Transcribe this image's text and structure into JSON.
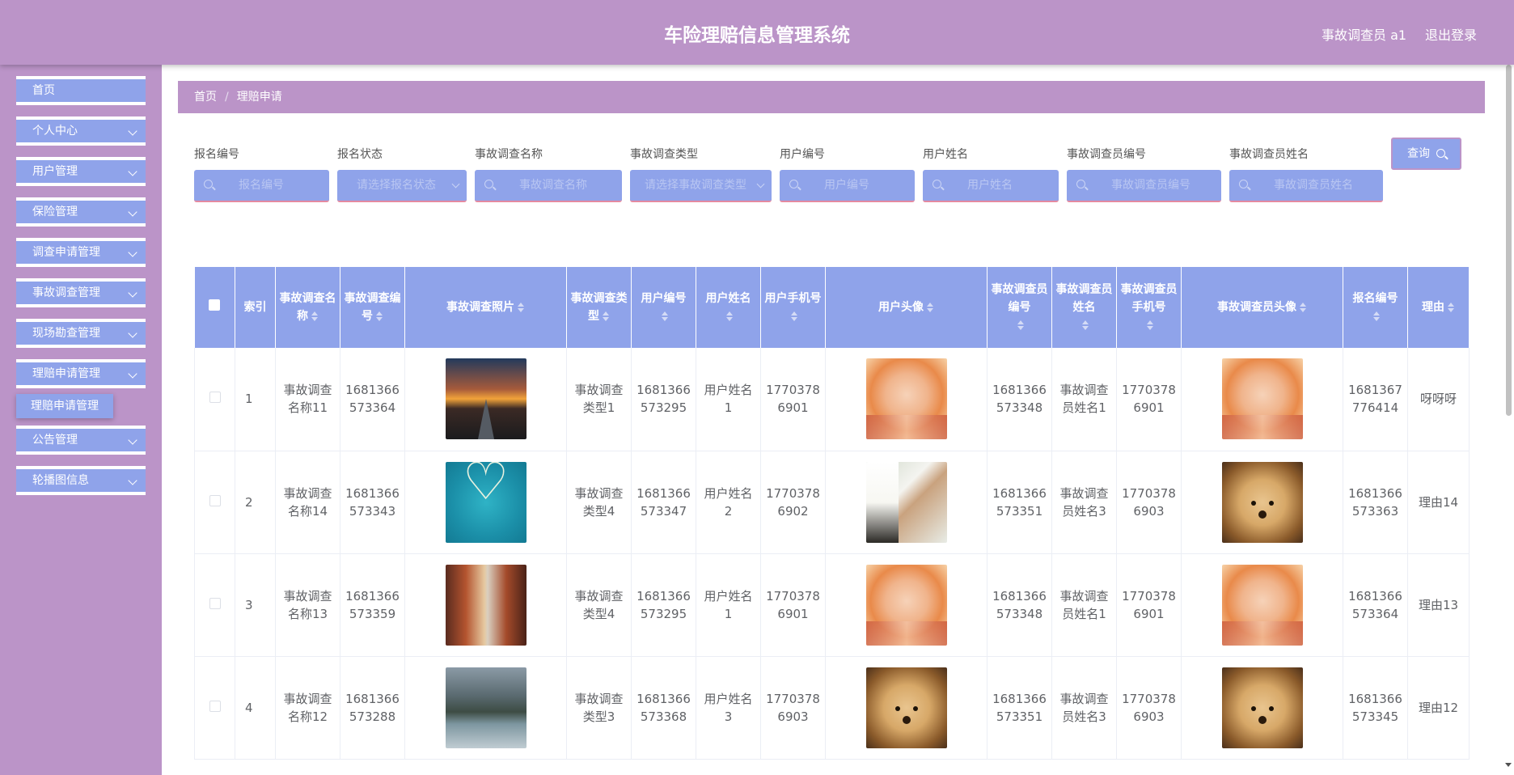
{
  "header": {
    "title": "车险理赔信息管理系统",
    "user": "事故调查员 a1",
    "logout": "退出登录"
  },
  "sidebar": {
    "items": [
      {
        "label": "首页"
      },
      {
        "label": "个人中心"
      },
      {
        "label": "用户管理"
      },
      {
        "label": "保险管理"
      },
      {
        "label": "调查申请管理"
      },
      {
        "label": "事故调查管理"
      },
      {
        "label": "现场勘查管理"
      },
      {
        "label": "理赔申请管理"
      },
      {
        "label": "公告管理"
      },
      {
        "label": "轮播图信息"
      }
    ],
    "active_sub": "理赔申请管理"
  },
  "breadcrumb": {
    "home": "首页",
    "current": "理赔申请"
  },
  "search": {
    "fields": [
      {
        "label": "报名编号",
        "placeholder": "报名编号"
      },
      {
        "label": "报名状态",
        "placeholder": "请选择报名状态"
      },
      {
        "label": "事故调查名称",
        "placeholder": "事故调查名称"
      },
      {
        "label": "事故调查类型",
        "placeholder": "请选择事故调查类型"
      },
      {
        "label": "用户编号",
        "placeholder": "用户编号"
      },
      {
        "label": "用户姓名",
        "placeholder": "用户姓名"
      },
      {
        "label": "事故调查员编号",
        "placeholder": "事故调查员编号"
      },
      {
        "label": "事故调查员姓名",
        "placeholder": "事故调查员姓名"
      }
    ],
    "button": "查询"
  },
  "table": {
    "headers": [
      "索引",
      "事故调查名称",
      "事故调查编号",
      "事故调查照片",
      "事故调查类型",
      "用户编号",
      "用户姓名",
      "用户手机号",
      "用户头像",
      "事故调查员编号",
      "事故调查员姓名",
      "事故调查员手机号",
      "事故调查员头像",
      "报名编号",
      "理由"
    ],
    "rows": [
      {
        "index": "1",
        "name": "事故调查名称11",
        "code": "1681366573364",
        "photo": "sunset-road",
        "type": "事故调查类型1",
        "user_no": "1681366573295",
        "user_name": "用户姓名1",
        "phone": "17703786901",
        "avatar": "smiling-girl",
        "inv_no": "1681366573348",
        "inv_name": "事故调查员姓名1",
        "inv_phone": "17703786901",
        "inv_avatar": "smiling-girl",
        "apply_no": "1681367776414",
        "reason": "呀呀呀"
      },
      {
        "index": "2",
        "name": "事故调查名称14",
        "code": "1681366573343",
        "photo": "heart-island",
        "type": "事故调查类型4",
        "user_no": "1681366573347",
        "user_name": "用户姓名2",
        "phone": "17703786902",
        "avatar": "girl-flowers",
        "inv_no": "1681366573351",
        "inv_name": "事故调查员姓名3",
        "inv_phone": "17703786903",
        "inv_avatar": "puppy",
        "apply_no": "1681366573363",
        "reason": "理由14"
      },
      {
        "index": "3",
        "name": "事故调查名称13",
        "code": "1681366573359",
        "photo": "corridor",
        "type": "事故调查类型4",
        "user_no": "1681366573295",
        "user_name": "用户姓名1",
        "phone": "17703786901",
        "avatar": "smiling-girl",
        "inv_no": "1681366573348",
        "inv_name": "事故调查员姓名1",
        "inv_phone": "17703786901",
        "inv_avatar": "smiling-girl",
        "apply_no": "1681366573364",
        "reason": "理由13"
      },
      {
        "index": "4",
        "name": "事故调查名称12",
        "code": "1681366573288",
        "photo": "mountain-lake",
        "type": "事故调查类型3",
        "user_no": "1681366573368",
        "user_name": "用户姓名3",
        "phone": "17703786903",
        "avatar": "puppy",
        "inv_no": "1681366573351",
        "inv_name": "事故调查员姓名3",
        "inv_phone": "17703786903",
        "inv_avatar": "puppy",
        "apply_no": "1681366573345",
        "reason": "理由12"
      }
    ]
  },
  "colors": {
    "header": "#bb94c8",
    "accent": "#8fa3ea"
  }
}
